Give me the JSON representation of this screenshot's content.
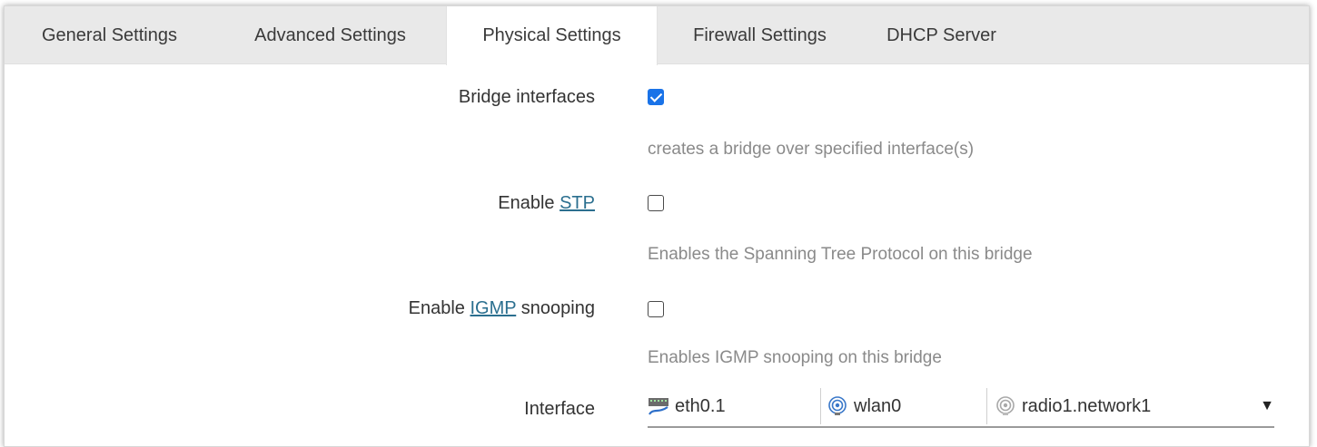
{
  "tabs": [
    {
      "label": "General Settings"
    },
    {
      "label": "Advanced Settings"
    },
    {
      "label": "Physical Settings",
      "active": true
    },
    {
      "label": "Firewall Settings"
    },
    {
      "label": "DHCP Server"
    }
  ],
  "bridge": {
    "label": "Bridge interfaces",
    "checked": true,
    "hint": "creates a bridge over specified interface(s)"
  },
  "stp": {
    "label_prefix": "Enable ",
    "link": "STP",
    "checked": false,
    "hint": "Enables the Spanning Tree Protocol on this bridge"
  },
  "igmp": {
    "label_prefix": "Enable ",
    "link": "IGMP",
    "label_suffix": " snooping",
    "checked": false,
    "hint": "Enables IGMP snooping on this bridge"
  },
  "interface": {
    "label": "Interface",
    "selected": [
      {
        "name": "eth0.1",
        "icon": "ethernet-port-icon"
      },
      {
        "name": "wlan0",
        "icon": "wifi-interface-icon"
      },
      {
        "name": "radio1.network1",
        "icon": "wifi-disabled-icon"
      }
    ],
    "dropdown_glyph": "▼"
  },
  "colors": {
    "accent": "#1a73e8",
    "link": "#2b6f8f",
    "hint": "#8a8a8a",
    "tabbar": "#e9e9e9"
  }
}
